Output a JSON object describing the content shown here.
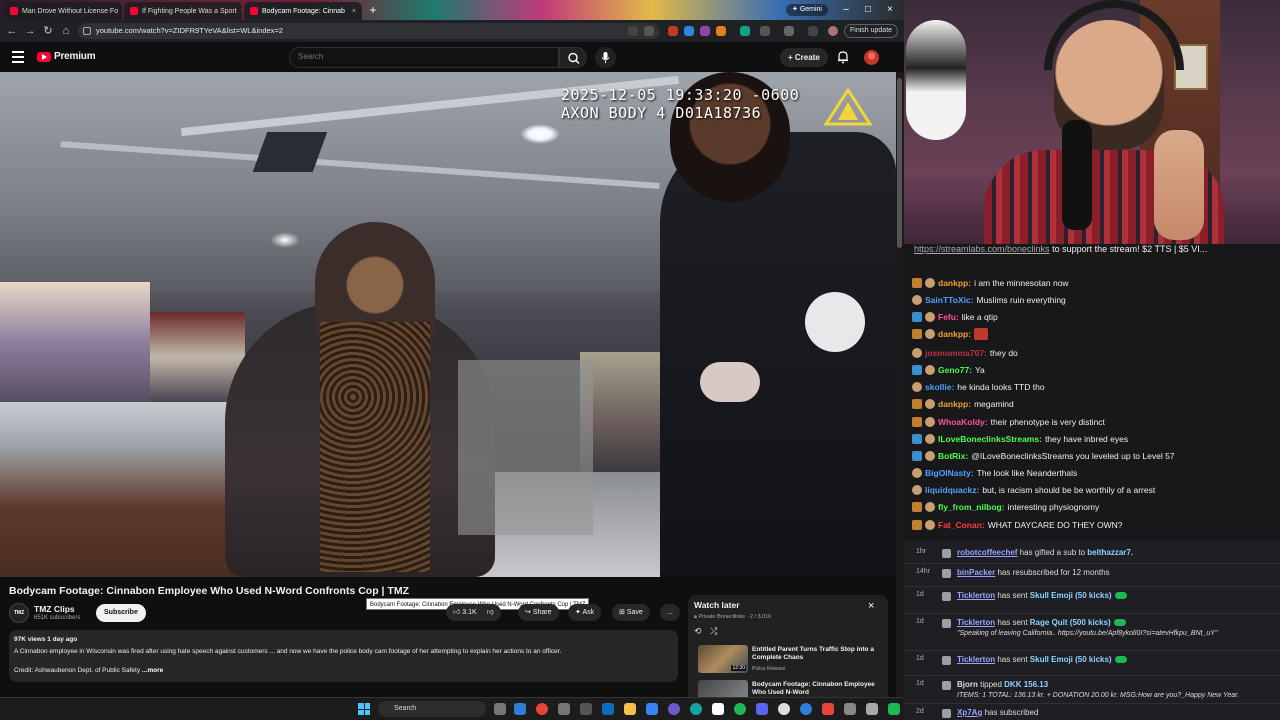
{
  "browser": {
    "tabs": [
      {
        "title": "Man Drove Without License Fo"
      },
      {
        "title": "If Fighting People Was a Sport"
      },
      {
        "title": "Bodycam Footage: Cinnab"
      }
    ],
    "gemini_label": "Gemini",
    "url": "youtube.com/watch?v=ZIDFR9TYeVA&list=WL&index=2",
    "finish_update": "Finish update"
  },
  "youtube": {
    "logo_text": "Premium",
    "search_placeholder": "Search",
    "create_label": "Create",
    "video": {
      "timestamp_line1": "2025-12-05 19:33:20 -0600",
      "timestamp_line2": "AXON BODY 4 D01A18736",
      "title": "Bodycam Footage: Cinnabon Employee Who Used N-Word Confronts Cop | TMZ",
      "tooltip": "Bodycam Footage: Cinnabon Employee Who Used N-Word Confronts Cop | TMZ"
    },
    "channel": {
      "name": "TMZ Clips",
      "subscribers": "651K subscribers",
      "avatar_text": "TMZ",
      "subscribe_label": "Subscribe"
    },
    "actions": {
      "likes": "3.1K",
      "share": "Share",
      "ask": "Ask",
      "save": "Save",
      "more": "..."
    },
    "description": {
      "meta": "97K views  1 day ago",
      "text": "A Cinnabon employee in Wisconsin was fired after using hate speech against customers ... and now we have the police body cam footage of her attempting to explain her actions to an officer.",
      "credit": "Credit: Ashwaubenon Dept. of Public Safety",
      "more": "...more"
    },
    "watch_later": {
      "title": "Watch later",
      "subtitle": "Private  Bonecllinks · 2 / 3,016",
      "items": [
        {
          "title": "Entitled Parent Turns Traffic Stop into a Complete Chaos",
          "channel": "Police Release",
          "duration": "12:30"
        },
        {
          "title": "Bodycam Footage: Cinnabon Employee Who Used N-Word",
          "channel": "",
          "duration": ""
        }
      ]
    }
  },
  "chat": {
    "banner_link": "https://streamlabs.com/boneclinks",
    "banner_text": " to support the stream! $2 TTS | $5 VI...",
    "messages": [
      {
        "user": "dankpp:",
        "text": "i am the minnesotan now",
        "color": "#f0a030",
        "badge": "#c08030"
      },
      {
        "user": "SainTToXic:",
        "text": "Muslims ruin everything",
        "color": "#4aa3ff",
        "badge": ""
      },
      {
        "user": "Fefu:",
        "text": "like a qtip",
        "color": "#ff4f9a",
        "badge": "#3a8fd0"
      },
      {
        "user": "dankpp:",
        "text": "",
        "color": "#f0a030",
        "badge": "#c08030"
      },
      {
        "user": "josmomma707:",
        "text": "they do",
        "color": "#c0304a",
        "badge": ""
      },
      {
        "user": "Geno77:",
        "text": "Ya",
        "color": "#4cff4c",
        "badge": "#3a8fd0"
      },
      {
        "user": "skollie:",
        "text": "he kinda looks TTD tho",
        "color": "#4aa3ff",
        "badge": ""
      },
      {
        "user": "dankpp:",
        "text": "megamind",
        "color": "#f0a030",
        "badge": "#c08030"
      },
      {
        "user": "WhoaKoldy:",
        "text": "their phenotype is very distinct",
        "color": "#ff4f9a",
        "badge": "#c08030"
      },
      {
        "user": "ILoveBoneclinksStreams:",
        "text": "they have inbred eyes",
        "color": "#4cff4c",
        "badge": "#3a8fd0"
      },
      {
        "user": "BotRix:",
        "text": "@ILoveBoneclinksStreams you leveled up to Level 57",
        "color": "#4cff4c",
        "badge": "#3a8fd0"
      },
      {
        "user": "BigOlNasty:",
        "text": "The look like Neanderthals",
        "color": "#4aa3ff",
        "badge": ""
      },
      {
        "user": "liquidquackz:",
        "text": "but, is racism should be be worthily of a arrest",
        "color": "#4aa3ff",
        "badge": ""
      },
      {
        "user": "fly_from_nilbog:",
        "text": "interesting physiognomy",
        "color": "#4cff4c",
        "badge": "#c08030"
      },
      {
        "user": "Fat_Conan:",
        "text": "WHAT DAYCARE DO THEY OWN?",
        "color": "#ff3a3a",
        "badge": "#c08030"
      }
    ]
  },
  "events": [
    {
      "time": "1hr",
      "user": "robotcoffeechef",
      "text": " has gifted a sub to ",
      "highlight": "belthazzar7.",
      "sub": "",
      "tag": false
    },
    {
      "time": "14hr",
      "user": "binPacker",
      "text": " has resubscribed for 12 months",
      "highlight": "",
      "sub": "",
      "tag": false
    },
    {
      "time": "1d",
      "user": "Ticklerton",
      "text": " has sent ",
      "highlight": "Skull Emoji (50 kicks)",
      "sub": "",
      "tag": true
    },
    {
      "time": "1d",
      "user": "Ticklerton",
      "text": " has sent ",
      "highlight": "Rage Quit (500 kicks)",
      "sub": "\"Speaking of leaving California.. https://youtu.be/Apf8ykolI0I?si=atevHfkpu_BNt_uY\"",
      "tag": true
    },
    {
      "time": "1d",
      "user": "Ticklerton",
      "text": " has sent ",
      "highlight": "Skull Emoji (50 kicks)",
      "sub": "",
      "tag": true
    },
    {
      "time": "1d",
      "user": "Bjorn",
      "text": " tipped ",
      "highlight": "DKK 156.13",
      "sub": "ITEMS: 1 TOTAL: 136.13 kr. + DONATION 20.00 kr. MSG:How are you?_Happy New Year.",
      "tag": false,
      "plainuser": true
    },
    {
      "time": "2d",
      "user": "Xp7Ag",
      "text": " has subscribed",
      "highlight": "",
      "sub": "",
      "tag": false
    }
  ],
  "taskbar": {
    "search_label": "Search"
  }
}
